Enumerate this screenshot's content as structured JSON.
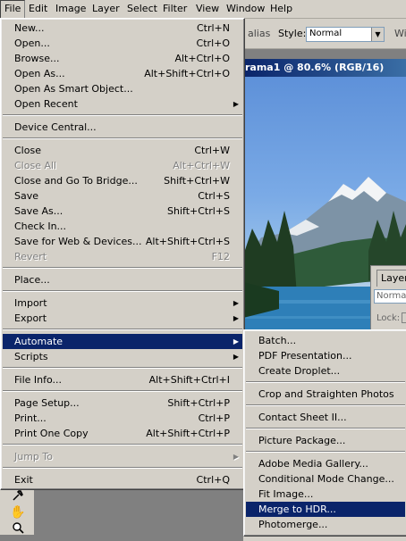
{
  "menubar": {
    "items": [
      "File",
      "Edit",
      "Image",
      "Layer",
      "Select",
      "Filter",
      "View",
      "Window",
      "Help"
    ]
  },
  "options_bar": {
    "antialias_text": "alias",
    "style_label": "Style:",
    "style_value": "Normal",
    "width_text": "Wi"
  },
  "document": {
    "title": "rama1 @ 80.6% (RGB/16)"
  },
  "layers_panel": {
    "tab": "Layers",
    "mode": "Normal",
    "lock_label": "Lock:"
  },
  "file_menu": {
    "items": [
      {
        "label": "New...",
        "shortcut": "Ctrl+N"
      },
      {
        "label": "Open...",
        "shortcut": "Ctrl+O"
      },
      {
        "label": "Browse...",
        "shortcut": "Alt+Ctrl+O"
      },
      {
        "label": "Open As...",
        "shortcut": "Alt+Shift+Ctrl+O"
      },
      {
        "label": "Open As Smart Object..."
      },
      {
        "label": "Open Recent",
        "submenu": true
      },
      {
        "separator": true
      },
      {
        "label": "Device Central..."
      },
      {
        "separator": true
      },
      {
        "label": "Close",
        "shortcut": "Ctrl+W"
      },
      {
        "label": "Close All",
        "shortcut": "Alt+Ctrl+W",
        "disabled": true
      },
      {
        "label": "Close and Go To Bridge...",
        "shortcut": "Shift+Ctrl+W"
      },
      {
        "label": "Save",
        "shortcut": "Ctrl+S"
      },
      {
        "label": "Save As...",
        "shortcut": "Shift+Ctrl+S"
      },
      {
        "label": "Check In..."
      },
      {
        "label": "Save for Web & Devices...",
        "shortcut": "Alt+Shift+Ctrl+S"
      },
      {
        "label": "Revert",
        "shortcut": "F12",
        "disabled": true
      },
      {
        "separator": true
      },
      {
        "label": "Place..."
      },
      {
        "separator": true
      },
      {
        "label": "Import",
        "submenu": true
      },
      {
        "label": "Export",
        "submenu": true
      },
      {
        "separator": true
      },
      {
        "label": "Automate",
        "submenu": true,
        "highlighted": true
      },
      {
        "label": "Scripts",
        "submenu": true
      },
      {
        "separator": true
      },
      {
        "label": "File Info...",
        "shortcut": "Alt+Shift+Ctrl+I"
      },
      {
        "separator": true
      },
      {
        "label": "Page Setup...",
        "shortcut": "Shift+Ctrl+P"
      },
      {
        "label": "Print...",
        "shortcut": "Ctrl+P"
      },
      {
        "label": "Print One Copy",
        "shortcut": "Alt+Shift+Ctrl+P"
      },
      {
        "separator": true
      },
      {
        "label": "Jump To",
        "submenu": true,
        "disabled": true
      },
      {
        "separator": true
      },
      {
        "label": "Exit",
        "shortcut": "Ctrl+Q"
      }
    ]
  },
  "automate_menu": {
    "items": [
      {
        "label": "Batch..."
      },
      {
        "label": "PDF Presentation..."
      },
      {
        "label": "Create Droplet..."
      },
      {
        "separator": true
      },
      {
        "label": "Crop and Straighten Photos"
      },
      {
        "separator": true
      },
      {
        "label": "Contact Sheet II..."
      },
      {
        "separator": true
      },
      {
        "label": "Picture Package..."
      },
      {
        "separator": true
      },
      {
        "label": "Adobe Media Gallery..."
      },
      {
        "label": "Conditional Mode Change..."
      },
      {
        "label": "Fit Image..."
      },
      {
        "label": "Merge to HDR...",
        "highlighted": true
      },
      {
        "label": "Photomerge..."
      }
    ]
  },
  "colors": {
    "menu_bg": "#d4d0c8",
    "highlight": "#0a246a",
    "disabled_text": "#808080",
    "title_bar": "#0a246a"
  },
  "icons": [
    "eyedropper-tool-icon",
    "hand-tool-icon",
    "zoom-tool-icon",
    "submenu-arrow-icon",
    "dropdown-arrow-icon"
  ]
}
